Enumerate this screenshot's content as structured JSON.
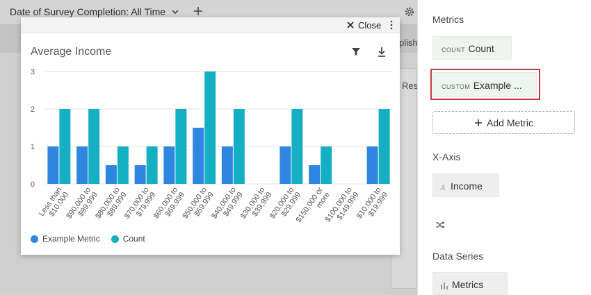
{
  "topbar": {
    "filter_label": "Date of Survey Completion: All Time"
  },
  "background": {
    "partial_text_1": "plish",
    "partial_text_2": "Res"
  },
  "modal": {
    "close_label": "Close",
    "title": "Average Income"
  },
  "chart_data": {
    "type": "bar",
    "title": "Average Income",
    "categories": [
      "Less than $10,000",
      "$90,000 to $99,999",
      "$80,000 to $89,999",
      "$70,000 to $79,999",
      "$60,000 to $69,999",
      "$50,000 to $59,999",
      "$40,000 to $49,999",
      "$30,000 to $39,999",
      "$20,000 to $29,999",
      "$150,000 or more",
      "$100,000 to $149,999",
      "$10,000 to $19,999"
    ],
    "category_lines": [
      [
        "Less than",
        "$10,000"
      ],
      [
        "$90,000 to",
        "$99,999"
      ],
      [
        "$80,000 to",
        "$89,999"
      ],
      [
        "$70,000 to",
        "$79,999"
      ],
      [
        "$60,000 to",
        "$69,999"
      ],
      [
        "$50,000 to",
        "$59,999"
      ],
      [
        "$40,000 to",
        "$49,999"
      ],
      [
        "$30,000 to",
        "$39,999"
      ],
      [
        "$20,000 to",
        "$29,999"
      ],
      [
        "$150,000 or",
        "more"
      ],
      [
        "$100,000 to",
        "$149,999"
      ],
      [
        "$10,000 to",
        "$19,999"
      ]
    ],
    "series": [
      {
        "name": "Example Metric",
        "color": "#2f86e0",
        "values": [
          1,
          1,
          0.5,
          0.5,
          1,
          1.5,
          1,
          0,
          1,
          0.5,
          0,
          1
        ]
      },
      {
        "name": "Count",
        "color": "#14afc3",
        "values": [
          2,
          2,
          1,
          1,
          2,
          3,
          2,
          0,
          2,
          1,
          0,
          2
        ]
      }
    ],
    "ylim": [
      0,
      3
    ],
    "yticks": [
      "0",
      "1",
      "2",
      "3"
    ],
    "grid": true,
    "legend": "bottom-left"
  },
  "sidebar": {
    "metrics_title": "Metrics",
    "metric_count_type": "COUNT",
    "metric_count_name": "Count",
    "metric_custom_type": "CUSTOM",
    "metric_custom_name": "Example ...",
    "add_metric_label": "Add Metric",
    "xaxis_title": "X-Axis",
    "xaxis_value": "Income",
    "data_series_title": "Data Series",
    "data_series_value": "Metrics"
  }
}
